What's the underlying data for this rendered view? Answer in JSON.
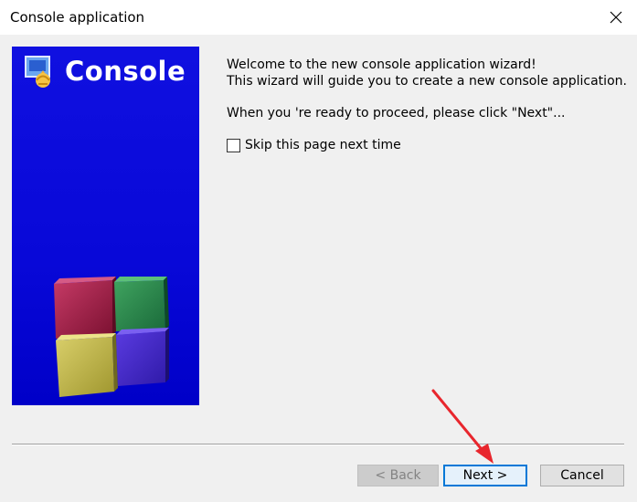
{
  "window": {
    "title": "Console application"
  },
  "banner": {
    "title": "Console"
  },
  "content": {
    "welcome_line1": "Welcome to the new console application wizard!",
    "welcome_line2": "This wizard will guide you to create a new console application.",
    "proceed_line": "When you 're ready to proceed, please click \"Next\"...",
    "skip_label": "Skip this page next time",
    "skip_checked": false
  },
  "buttons": {
    "back": "< Back",
    "next": "Next >",
    "cancel": "Cancel"
  },
  "colors": {
    "banner_blue": "#0a0ad8",
    "accent": "#0078d7",
    "arrow": "#e8262d"
  }
}
